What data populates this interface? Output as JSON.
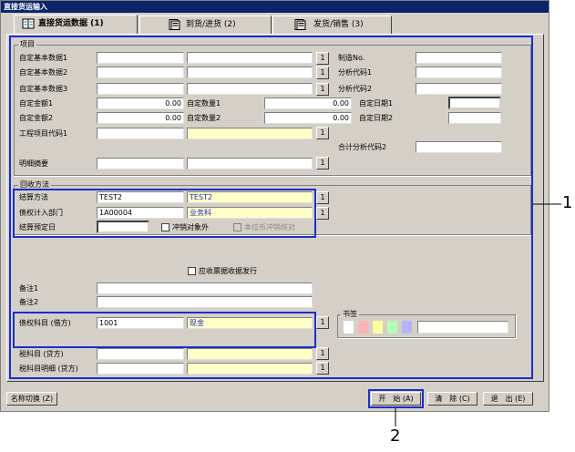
{
  "window": {
    "title": "直接货运输入"
  },
  "tabs": [
    {
      "label": "直接货运数据 (1)",
      "active": true
    },
    {
      "label": "到货/进货 (2)",
      "active": false
    },
    {
      "label": "发货/销售 (3)",
      "active": false
    }
  ],
  "items_group": {
    "title": "项目",
    "custom_basic_1": "自定基本数据1",
    "custom_basic_2": "自定基本数据2",
    "custom_basic_3": "自定基本数据3",
    "custom_amount_1": "自定金额1",
    "custom_amount_2": "自定金额2",
    "custom_amount_1_value": "0.00",
    "custom_amount_2_value": "0.00",
    "custom_qty_1": "自定数量1",
    "custom_qty_2": "自定数量2",
    "custom_qty_1_value": "0.00",
    "custom_qty_2_value": "0.00",
    "custom_date_1": "自定日期1",
    "custom_date_2": "自定日期2",
    "project_code_1": "工程项目代码1",
    "detail_summary": "明细摘要",
    "manufacture_no": "制造No.",
    "analysis_code_1": "分析代码1",
    "analysis_code_2": "分析代码2",
    "total_analysis_code_2": "合计分析代码2"
  },
  "collection_group": {
    "title": "回收方法",
    "settlement_method": "结算方法",
    "settlement_code": "TEST2",
    "settlement_name": "TEST2",
    "receivable_dept": "债权计入部门",
    "dept_code": "1A00004",
    "dept_name": "业务科",
    "settlement_date": "结算预定日",
    "offset_exclude": "冲销对象外",
    "local_currency_offset": "本位币冲销核对"
  },
  "receipt_issue": "应收票据收据发行",
  "remark_1": "备注1",
  "remark_2": "备注2",
  "receivable_account": "债权科目 (借方)",
  "receivable_account_code": "1001",
  "receivable_account_name": "现金",
  "tax_account": "税科目 (贷方)",
  "tax_account_detail": "税科目明细 (贷方)",
  "bookmark": {
    "title": "书签",
    "colors": [
      "#ffffff",
      "#ffb4b4",
      "#ffffa0",
      "#b4ffb4",
      "#b4b4ff"
    ]
  },
  "lookup_label": "1",
  "footer": {
    "name_switch": "名称切换 (Z)",
    "start": "开　始 (A)",
    "clear": "清　除 (C)",
    "exit": "退　出 (E)"
  },
  "callouts": {
    "one": "1",
    "two": "2"
  },
  "colors": {
    "highlight": "#1c2fc8",
    "titlebar": "#0a246a",
    "lookup_field": "#ffffc8"
  }
}
